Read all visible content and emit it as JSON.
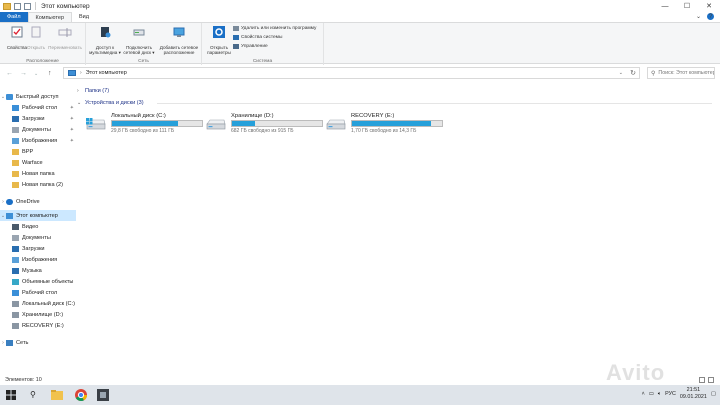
{
  "window": {
    "title": "Этот компьютер"
  },
  "ribbon_tabs": {
    "file": "Файл",
    "computer": "Компьютер",
    "view": "Вид"
  },
  "ribbon": {
    "location_group": "Расположение",
    "network_group": "Сеть",
    "system_group": "Система",
    "properties": "Свойства",
    "open": "Открыть",
    "rename": "Переименовать",
    "media_access": "Доступ к мультимедиа ▾",
    "map_drive": "Подключить сетевой диск ▾",
    "add_location": "Добавить сетевое расположение",
    "open_settings": "Открыть параметры",
    "uninstall": "Удалить или изменить программу",
    "system_props": "Свойства системы",
    "manage": "Управление"
  },
  "address": {
    "crumb": "Этот компьютер",
    "search_placeholder": "Поиск: Этот компьютер"
  },
  "sidebar": {
    "items": [
      {
        "label": "Быстрый доступ",
        "icon": "star-icon",
        "pinned": false
      },
      {
        "label": "Рабочий стол",
        "icon": "desktop-icon",
        "pinned": true
      },
      {
        "label": "Загрузки",
        "icon": "download-icon",
        "pinned": true
      },
      {
        "label": "Документы",
        "icon": "documents-icon",
        "pinned": true
      },
      {
        "label": "Изображения",
        "icon": "pictures-icon",
        "pinned": true
      },
      {
        "label": "BPP",
        "icon": "folder-icon",
        "pinned": false
      },
      {
        "label": "Warface",
        "icon": "folder-icon",
        "pinned": false
      },
      {
        "label": "Новая папка",
        "icon": "folder-icon",
        "pinned": false
      },
      {
        "label": "Новая папка (2)",
        "icon": "folder-icon",
        "pinned": false
      },
      {
        "label": "OneDrive",
        "icon": "cloud-icon",
        "pinned": false
      },
      {
        "label": "Этот компьютер",
        "icon": "computer-icon",
        "pinned": false
      },
      {
        "label": "Видео",
        "icon": "video-icon",
        "pinned": false
      },
      {
        "label": "Документы",
        "icon": "documents-icon",
        "pinned": false
      },
      {
        "label": "Загрузки",
        "icon": "download-icon",
        "pinned": false
      },
      {
        "label": "Изображения",
        "icon": "pictures-icon",
        "pinned": false
      },
      {
        "label": "Музыка",
        "icon": "music-icon",
        "pinned": false
      },
      {
        "label": "Объемные объекты",
        "icon": "3d-objects-icon",
        "pinned": false
      },
      {
        "label": "Рабочий стол",
        "icon": "desktop-icon",
        "pinned": false
      },
      {
        "label": "Локальный диск (C:)",
        "icon": "disk-icon",
        "pinned": false
      },
      {
        "label": "Хранилище (D:)",
        "icon": "disk-icon",
        "pinned": false
      },
      {
        "label": "RECOVERY (E:)",
        "icon": "disk-icon",
        "pinned": false
      },
      {
        "label": "Сеть",
        "icon": "network-icon",
        "pinned": false
      }
    ]
  },
  "content": {
    "folders_header": "Папки (7)",
    "devices_header": "Устройства и диски (3)",
    "drives": [
      {
        "name": "Локальный диск (C:)",
        "free_text": "29,8 ГБ свободно из 111 ГБ",
        "used_fraction": 0.73
      },
      {
        "name": "Хранилище (D:)",
        "free_text": "682 ГБ свободно из 915 ГБ",
        "used_fraction": 0.26
      },
      {
        "name": "RECOVERY (E:)",
        "free_text": "1,70 ГБ свободно из 14,3 ГБ",
        "used_fraction": 0.88
      }
    ]
  },
  "status": {
    "items_count": "Элементов: 10"
  },
  "taskbar": {
    "time": "21:51",
    "date": "09.01.2021",
    "lang": "РУС"
  },
  "watermark": "Avito",
  "colors": {
    "accent": "#1a6fc6",
    "selection": "#cce8ff",
    "drive_fill": "#26a0da",
    "folder": "#e8b84a"
  }
}
